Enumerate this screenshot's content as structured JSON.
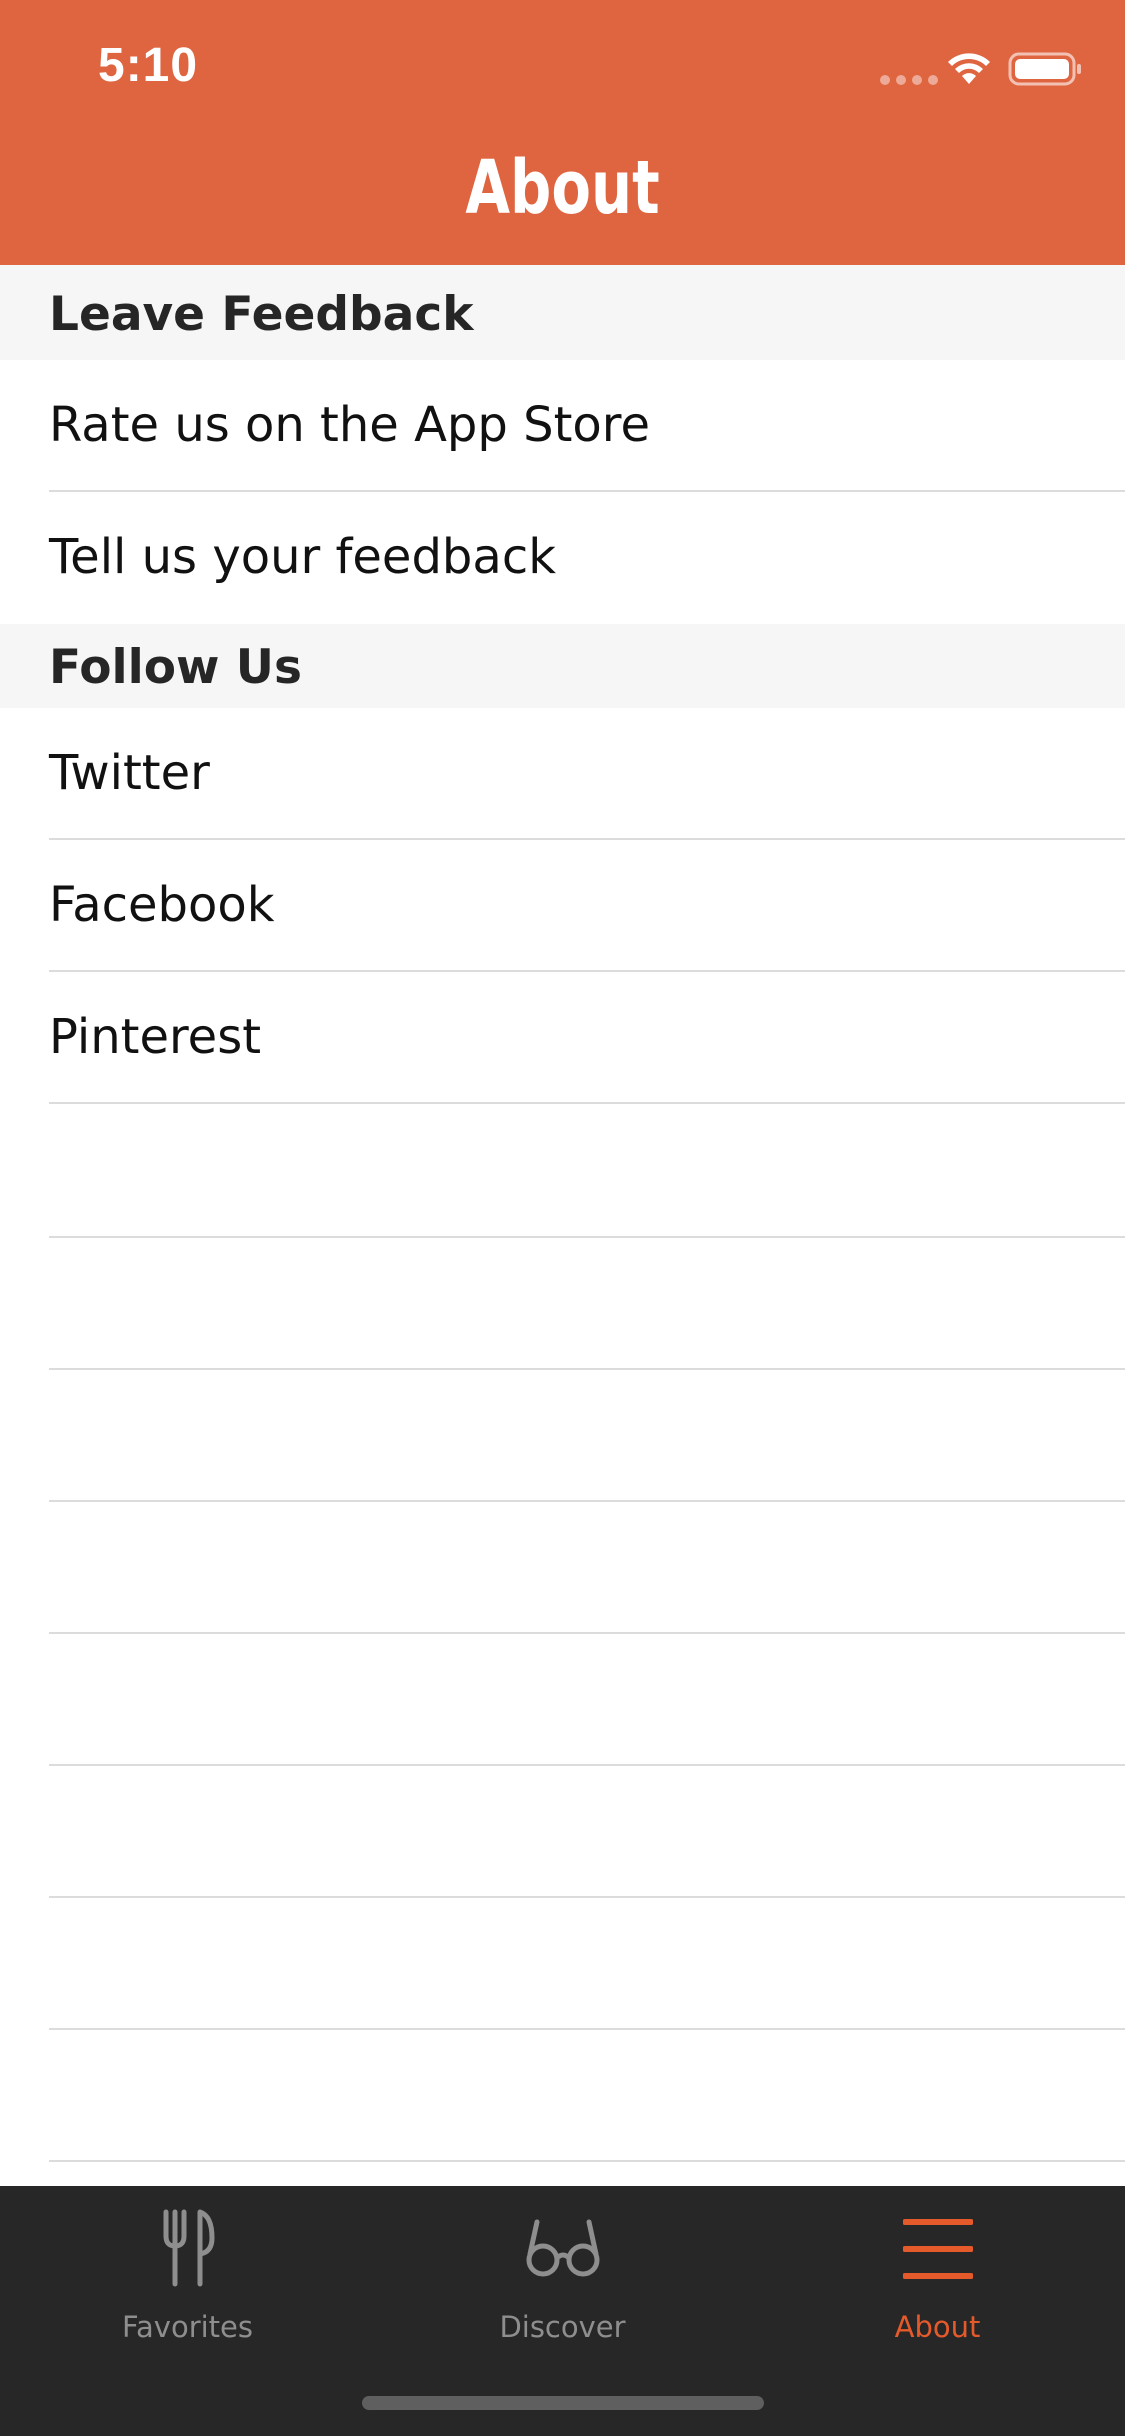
{
  "status_bar": {
    "time": "5:10"
  },
  "nav": {
    "title": "About"
  },
  "sections": [
    {
      "title": "Leave Feedback",
      "items": [
        "Rate us on the App Store",
        "Tell us your feedback"
      ]
    },
    {
      "title": "Follow Us",
      "items": [
        "Twitter",
        "Facebook",
        "Pinterest"
      ]
    }
  ],
  "tab_bar": {
    "tabs": [
      {
        "label": "Favorites",
        "icon": "fork-knife-icon",
        "selected": false
      },
      {
        "label": "Discover",
        "icon": "glasses-icon",
        "selected": false
      },
      {
        "label": "About",
        "icon": "menu-icon",
        "selected": true
      }
    ]
  },
  "colors": {
    "accent": "#df6541",
    "tab_active": "#e55a2b",
    "tab_inactive": "#8e8e8e",
    "tab_bar_bg": "#272727",
    "section_bg": "#f6f6f6"
  }
}
